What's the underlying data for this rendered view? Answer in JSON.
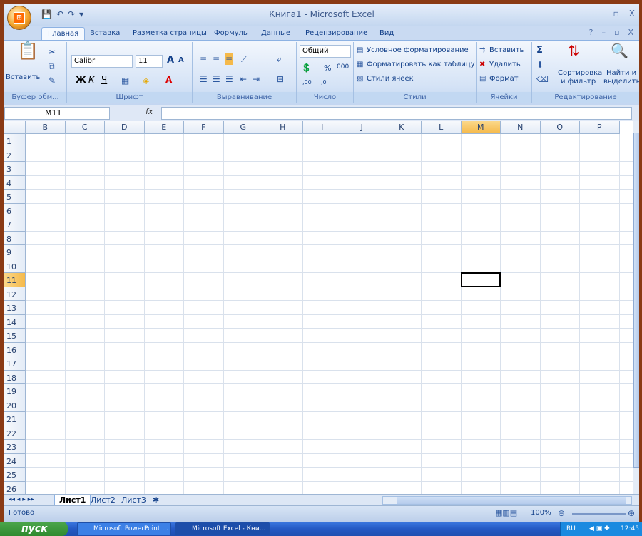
{
  "window": {
    "title": "Книга1 - Microsoft Excel",
    "controls": [
      "–",
      "▫",
      "X"
    ],
    "inner_controls": [
      "?",
      "–",
      "▫",
      "X"
    ]
  },
  "qat": [
    "💾",
    "↶",
    "↷",
    "▾"
  ],
  "tabs": [
    "Главная",
    "Вставка",
    "Разметка страницы",
    "Формулы",
    "Данные",
    "Рецензирование",
    "Вид"
  ],
  "ribbon": {
    "clipboard": {
      "label": "Буфер обм...",
      "paste": "Вставить"
    },
    "font": {
      "label": "Шрифт",
      "name": "Calibri",
      "size": "11",
      "bold": "Ж",
      "italic": "К",
      "underline": "Ч",
      "grow": "A",
      "shrink": "A"
    },
    "alignment": {
      "label": "Выравнивание"
    },
    "number": {
      "label": "Число",
      "format": "Общий",
      "percent": "%",
      "thousands": "000",
      "dec_inc": ",00",
      "dec_dec": ",0"
    },
    "styles": {
      "label": "Стили",
      "cond": "Условное форматирование",
      "table": "Форматировать как таблицу",
      "cell": "Стили ячеек"
    },
    "cells": {
      "label": "Ячейки",
      "insert": "Вставить",
      "delete": "Удалить",
      "format": "Формат"
    },
    "editing": {
      "label": "Редактирование",
      "sigma": "Σ",
      "sort": "Сортировка",
      "sort2": "и фильтр",
      "find": "Найти и",
      "find2": "выделить"
    }
  },
  "formula_bar": {
    "name_box": "M11",
    "fx": "fx",
    "value": ""
  },
  "columns": [
    "B",
    "C",
    "D",
    "E",
    "F",
    "G",
    "H",
    "I",
    "J",
    "K",
    "L",
    "M",
    "N",
    "O",
    "P"
  ],
  "rows": [
    "1",
    "2",
    "3",
    "4",
    "5",
    "6",
    "7",
    "8",
    "9",
    "10",
    "11",
    "12",
    "13",
    "14",
    "15",
    "16",
    "17",
    "18",
    "19",
    "20",
    "21",
    "22",
    "23",
    "24",
    "25",
    "26"
  ],
  "selected": {
    "column": "M",
    "row": "11"
  },
  "sheets": [
    "Лист1",
    "Лист2",
    "Лист3"
  ],
  "status": {
    "text": "Готово",
    "zoom": "100%"
  },
  "taskbar": {
    "start": "пуск",
    "items": [
      "Microsoft PowerPoint ...",
      "Microsoft Excel - Кни..."
    ],
    "lang": "RU",
    "time": "12:45"
  },
  "colors": {
    "accent": "#15428b",
    "selected_header": "#f5b94a",
    "background": "#8a3a14"
  }
}
